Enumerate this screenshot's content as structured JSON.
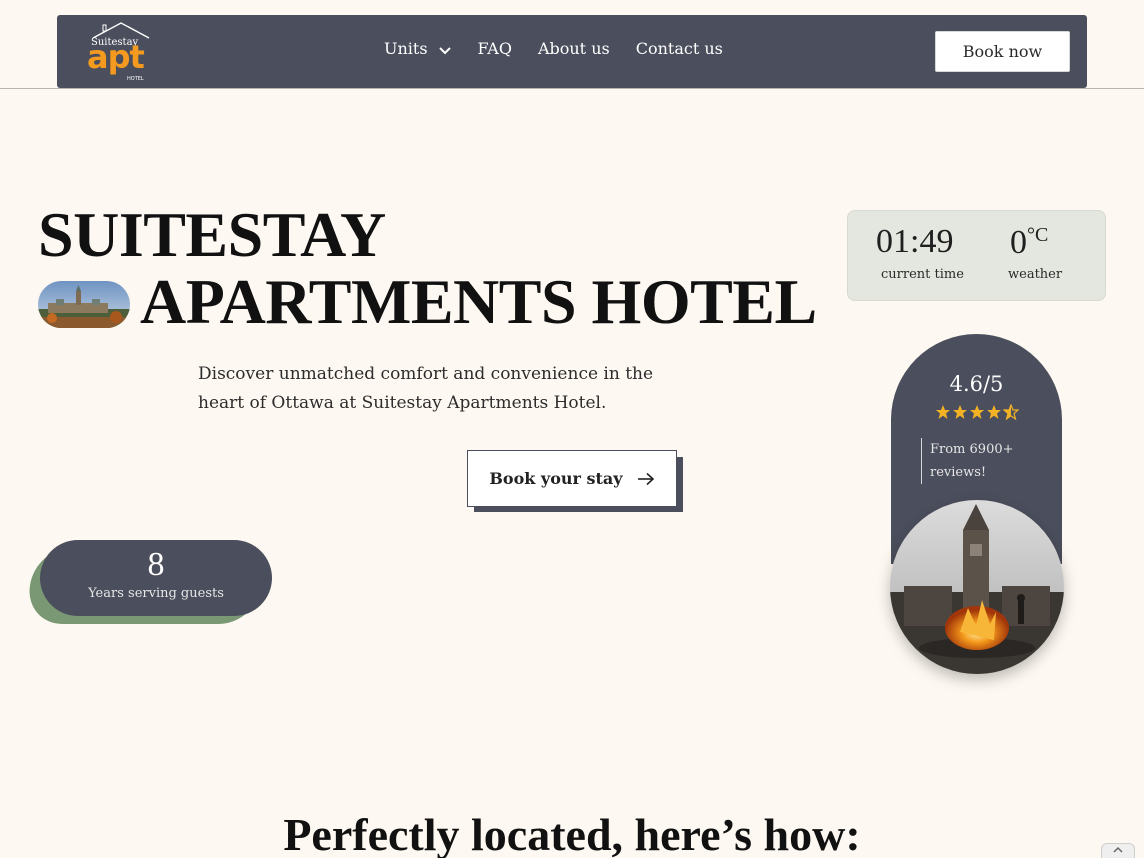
{
  "header": {
    "logo": {
      "top_text": "Suitestay",
      "main_text": "apt",
      "bottom_text": "HOTEL"
    },
    "nav": [
      {
        "label": "Units",
        "has_dropdown": true
      },
      {
        "label": "FAQ"
      },
      {
        "label": "About us"
      },
      {
        "label": "Contact us"
      }
    ],
    "book_now_label": "Book now"
  },
  "hero": {
    "title_line_1": "SUITESTAY",
    "title_line_2": "APARTMENTS HOTEL",
    "description": "Discover unmatched comfort and convenience in the heart of Ottawa at Suitestay Apartments Hotel.",
    "cta_label": "Book your stay"
  },
  "years": {
    "value": "8",
    "label": "Years serving guests"
  },
  "status": {
    "time_value": "01:49",
    "time_label": "current time",
    "temp_value": "0",
    "temp_unit": "°C",
    "temp_label": "weather"
  },
  "rating": {
    "value": "4.6/5",
    "stars": 4.5,
    "subtitle": "From 6900+ reviews!"
  },
  "section": {
    "title": "Perfectly located, here’s how:"
  },
  "colors": {
    "background": "#fdf8f1",
    "nav_bg": "#4b4e5c",
    "logo_orange": "#f39a1f",
    "star_gold": "#f2b225",
    "sage_green": "#7a9874",
    "weather_card": "#e4e7df"
  }
}
